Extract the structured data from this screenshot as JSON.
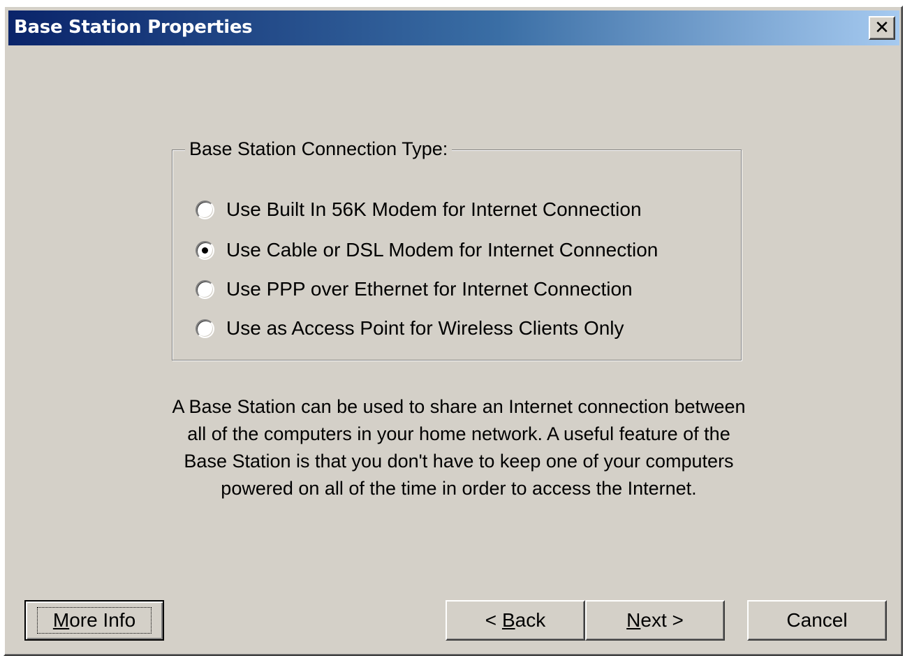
{
  "window": {
    "title": "Base Station Properties",
    "close_label": "✕"
  },
  "connection_group": {
    "legend": "Base Station Connection Type:",
    "options": [
      {
        "label": "Use Built In 56K Modem for Internet Connection",
        "selected": false
      },
      {
        "label": "Use Cable or DSL Modem for Internet Connection",
        "selected": true
      },
      {
        "label": "Use PPP over Ethernet for Internet Connection",
        "selected": false
      },
      {
        "label": "Use as Access Point for Wireless Clients Only",
        "selected": false
      }
    ]
  },
  "description": {
    "lines": [
      "A Base Station can be used to share an Internet connection between",
      "all of the computers in your home network.  A useful feature of the",
      "Base Station is that you don't have to keep one of your computers",
      "powered on all of the time in order to access the Internet."
    ]
  },
  "buttons": {
    "more_info": {
      "mnemonic": "M",
      "rest": "ore Info"
    },
    "back": {
      "prefix": "< ",
      "mnemonic": "B",
      "rest": "ack"
    },
    "next": {
      "mnemonic": "N",
      "rest": "ext >"
    },
    "cancel": "Cancel"
  },
  "colors": {
    "face": "#d4d0c8",
    "title_start": "#0a246a",
    "title_end": "#a6caf0"
  }
}
